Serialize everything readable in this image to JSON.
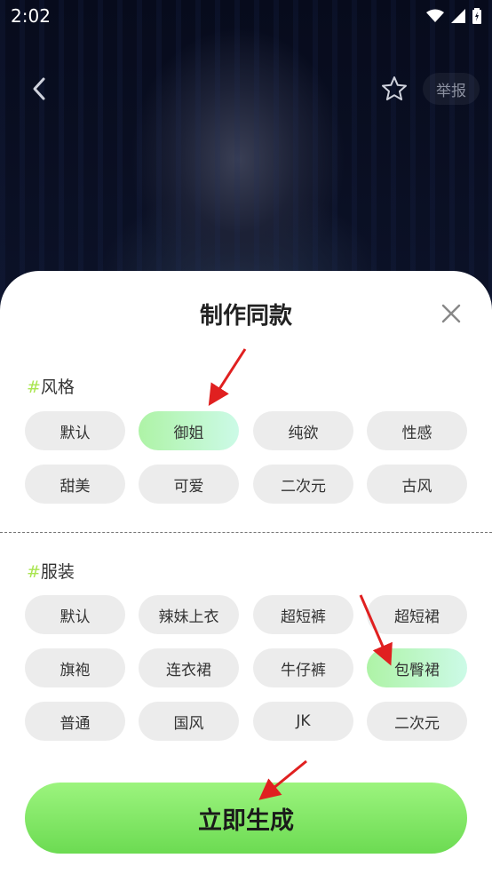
{
  "status_bar": {
    "time": "2:02"
  },
  "header": {
    "report_label": "举报"
  },
  "sheet": {
    "title": "制作同款",
    "style_section": {
      "hash": "#",
      "title": "风格",
      "chips": [
        "默认",
        "御姐",
        "纯欲",
        "性感",
        "甜美",
        "可爱",
        "二次元",
        "古风"
      ],
      "selected": "御姐"
    },
    "outfit_section": {
      "hash": "#",
      "title": "服装",
      "chips": [
        "默认",
        "辣妹上衣",
        "超短裤",
        "超短裙",
        "旗袍",
        "连衣裙",
        "牛仔裤",
        "包臀裙",
        "普通",
        "国风",
        "JK",
        "二次元"
      ],
      "selected": "包臀裙"
    },
    "generate_label": "立即生成"
  },
  "colors": {
    "accent_green": "#7be35e",
    "hash_color": "#a9e54f",
    "chip_bg": "#ececec",
    "annotation_red": "#e02020"
  }
}
